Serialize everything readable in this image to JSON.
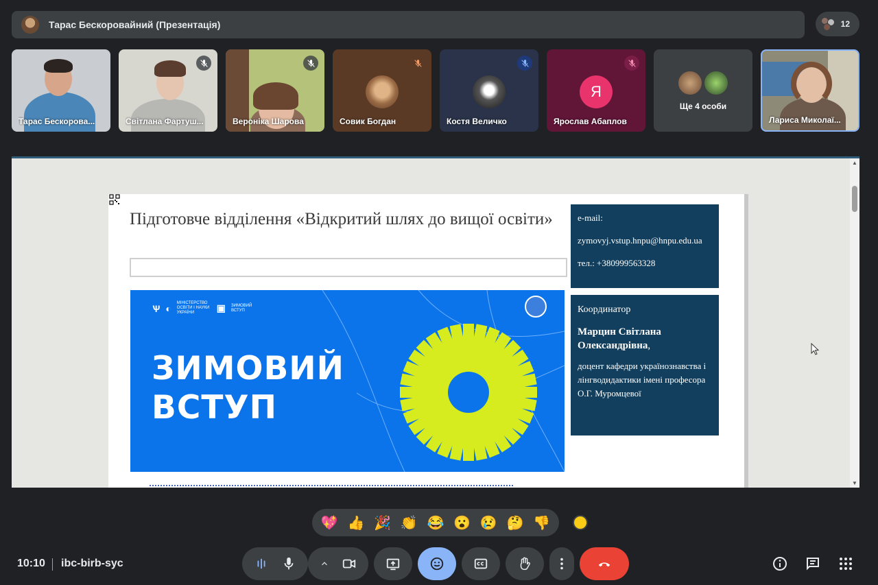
{
  "topbar": {
    "presenter_title": "Тарас Бескоровайний (Презентація)",
    "participant_count": "12"
  },
  "tiles": [
    {
      "name": "Тарас Бескорова...",
      "muted": false
    },
    {
      "name": "Світлана Фартуш...",
      "muted": true
    },
    {
      "name": "Вероніка Шарова",
      "muted": true
    },
    {
      "name": "Совик Богдан",
      "muted": true
    },
    {
      "name": "Костя Величко",
      "muted": true
    },
    {
      "name": "Ярослав Абаплов",
      "muted": true,
      "initial": "Я"
    },
    {
      "name": "Ще 4 особи",
      "muted": false
    },
    {
      "name": "Лариса Миколаї...",
      "muted": false
    }
  ],
  "slide": {
    "heading": "Підготовче відділення «Відкритий шлях до вищої освіти»",
    "banner": {
      "title_line1": "ЗИМОВИЙ",
      "title_line2": "ВСТУП",
      "ministry": "МІНІСТЕРСТВО ОСВІТИ І НАУКИ УКРАЇНИ",
      "program": "ЗИМОВИЙ ВСТУП"
    },
    "contact": {
      "email_label": "e-mail:",
      "email": "zymovyj.vstup.hnpu@hnpu.edu.ua",
      "phone": "тел.: +380999563328"
    },
    "coordinator": {
      "label": "Координатор",
      "name": "Марцин Світлана Олександрівна",
      "comma": ",",
      "position": "доцент кафедри українознавства і лінгводидактики імені професора О.Г. Муромцевої"
    }
  },
  "reactions": [
    "💖",
    "👍",
    "🎉",
    "👏",
    "😂",
    "😮",
    "😢",
    "🤔",
    "👎"
  ],
  "footer": {
    "time": "10:10",
    "meeting_code": "ibc-birb-syc"
  },
  "colors": {
    "end_call": "#ea4335",
    "active_control": "#8ab4f8",
    "card_bg": "#123f5d",
    "banner_bg": "#0c74ea",
    "sun": "#d6ec1e"
  }
}
